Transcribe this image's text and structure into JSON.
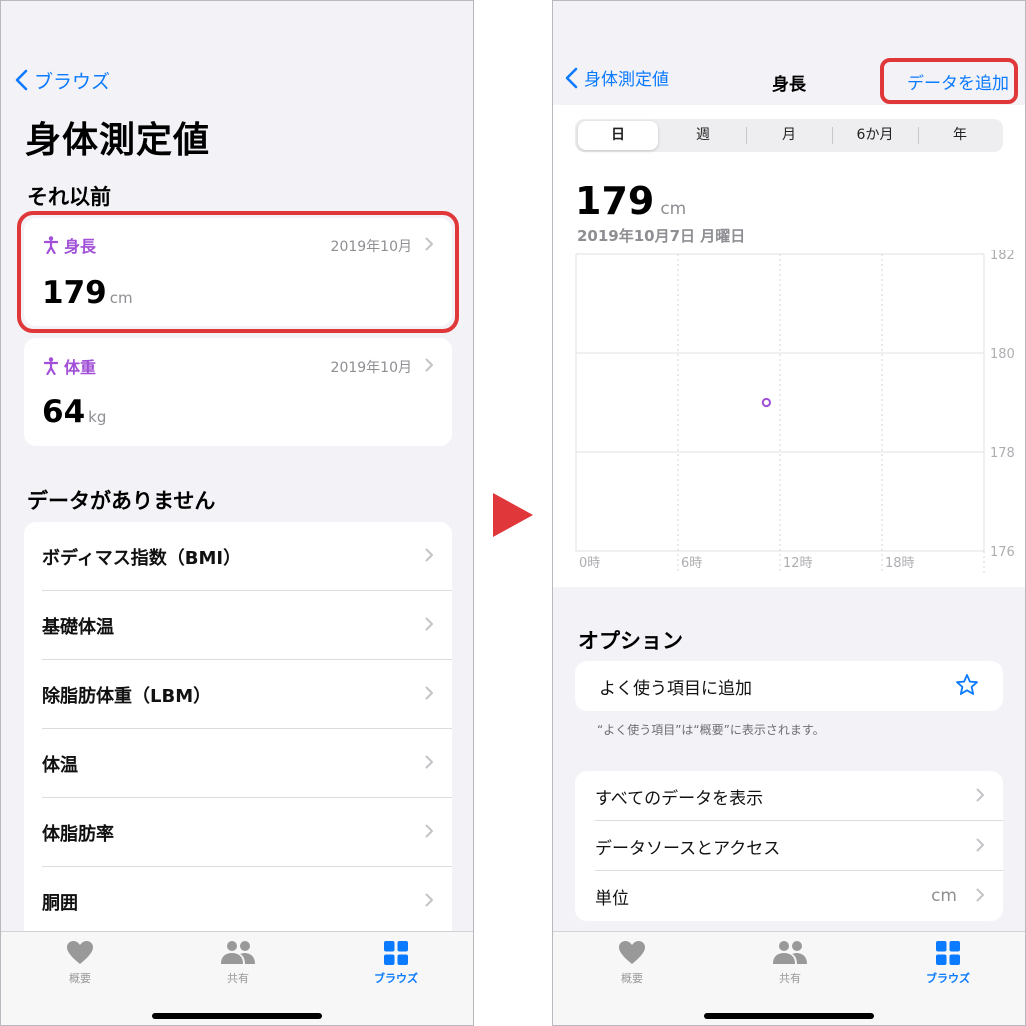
{
  "left": {
    "back_label": "ブラウズ",
    "title": "身体測定値",
    "section_previous": "それ以前",
    "cards": [
      {
        "label": "身長",
        "date": "2019年10月",
        "value": "179",
        "unit": "cm"
      },
      {
        "label": "体重",
        "date": "2019年10月",
        "value": "64",
        "unit": "kg"
      }
    ],
    "section_no_data": "データがありません",
    "list": [
      "ボディマス指数（BMI）",
      "基礎体温",
      "除脂肪体重（LBM）",
      "体温",
      "体脂肪率",
      "胴囲"
    ]
  },
  "tabbar": {
    "summary": "概要",
    "sharing": "共有",
    "browse": "ブラウズ"
  },
  "right": {
    "back_label": "身体測定値",
    "title": "身長",
    "add_label": "データを追加",
    "segments": [
      "日",
      "週",
      "月",
      "6か月",
      "年"
    ],
    "selected_segment": "日",
    "value": "179",
    "unit": "cm",
    "date": "2019年10月7日 月曜日",
    "options_title": "オプション",
    "favorite_label": "よく使う項目に追加",
    "footnote": "“よく使う項目”は“概要”に表示されます。",
    "rows": [
      {
        "label": "すべてのデータを表示",
        "value": ""
      },
      {
        "label": "データソースとアクセス",
        "value": ""
      },
      {
        "label": "単位",
        "value": "cm"
      }
    ]
  },
  "colors": {
    "accent": "#0a7aff",
    "purple": "#a04fd6",
    "highlight": "#e0373a"
  },
  "chart_data": {
    "type": "scatter",
    "x_ticks": [
      "0時",
      "6時",
      "12時",
      "18時"
    ],
    "y_ticks": [
      "182",
      "180",
      "178",
      "176"
    ],
    "ylim": [
      176,
      182
    ],
    "xlim_hours": [
      0,
      24
    ],
    "points": [
      {
        "x_hour": 11.2,
        "y": 179
      }
    ]
  }
}
